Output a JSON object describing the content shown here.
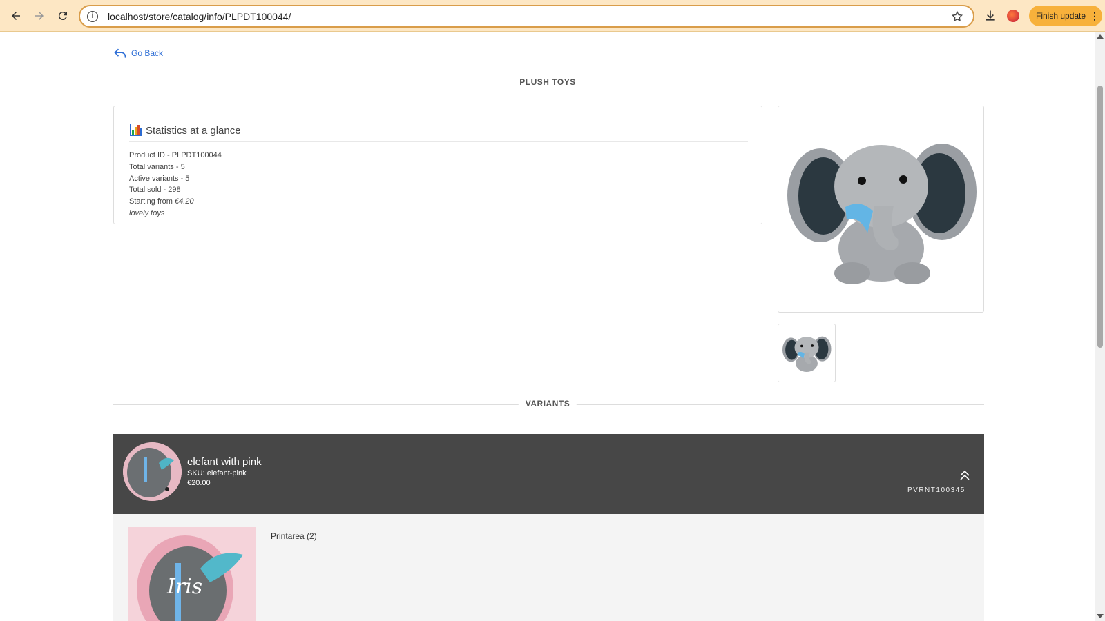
{
  "browser": {
    "url": "localhost/store/catalog/info/PLPDT100044/",
    "finish_update_label": "Finish update"
  },
  "page": {
    "go_back_label": "Go Back",
    "section_plush": "PLUSH TOYS",
    "section_variants": "VARIANTS"
  },
  "stats": {
    "title": "Statistics at a glance",
    "product_id": "Product ID - PLPDT100044",
    "total_variants": "Total variants - 5",
    "active_variants": "Active variants - 5",
    "total_sold": "Total sold - 298",
    "starting_from_label": "Starting from ",
    "starting_from_price": "€4.20",
    "description": "lovely toys"
  },
  "variant": {
    "name": "elefant with pink",
    "sku": "SKU: elefant-pink",
    "price": "€20.00",
    "code": "PVRNT100345",
    "printarea_label": "Printarea (2)",
    "print_text": "Iris"
  }
}
